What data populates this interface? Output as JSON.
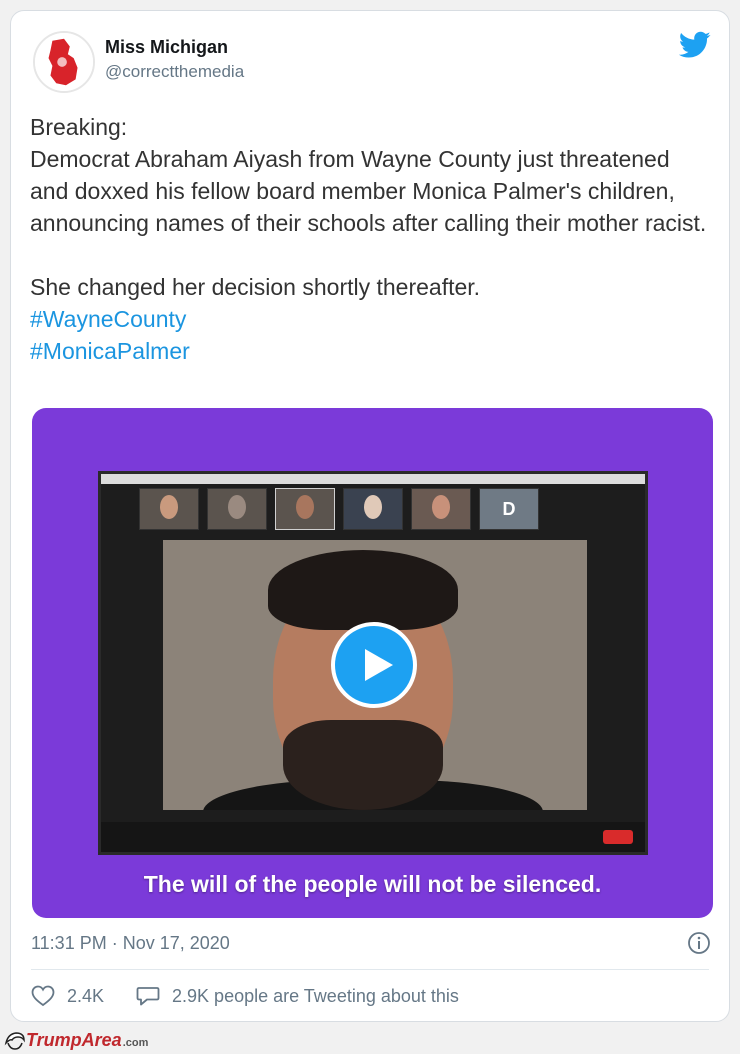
{
  "tweet": {
    "author_name": "Miss Michigan",
    "author_handle": "@correctthemedia",
    "text_lines": {
      "l1": "Breaking:",
      "l2": "Democrat Abraham Aiyash from Wayne County just threatened and doxxed his fellow board member Monica Palmer's children, announcing names of their schools after calling their mother racist.",
      "l3": "She changed her decision shortly thereafter."
    },
    "hashtags": [
      "#WayneCounty",
      "#MonicaPalmer"
    ],
    "media_caption": "The will of the people will not be silenced.",
    "timestamp": "11:31 PM · Nov 17, 2020",
    "likes": "2.4K",
    "replies_text": "2.9K people are Tweeting about this"
  },
  "watermark": {
    "brand": "TrumpArea",
    "suffix": ".com"
  },
  "colors": {
    "twitter_blue": "#1da1f2",
    "hashtag_blue": "#1b95e0",
    "media_purple": "#7b3ad9",
    "muted_text": "#657786",
    "watermark_red": "#c0282d"
  },
  "icons": {
    "brand": "twitter-bird-icon",
    "play": "play-icon",
    "info": "info-icon",
    "like": "heart-icon",
    "reply": "speech-bubble-icon"
  }
}
